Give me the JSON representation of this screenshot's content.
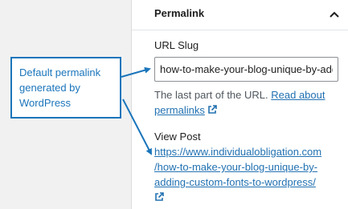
{
  "panel": {
    "title": "Permalink",
    "slug_label": "URL Slug",
    "slug_value": "how-to-make-your-blog-unique-by-adding-custom-fonts-to-wordpress",
    "help_text": "The last part of the URL.",
    "help_link": "Read about permalinks",
    "view_label": "View Post",
    "view_url_lines": [
      "https://www.individualobligation.com",
      "/how-to-make-your-blog-unique-by-",
      "adding-custom-fonts-to-wordpress/"
    ]
  },
  "callout": {
    "lines": [
      "Default permalink",
      "generated by",
      "WordPress"
    ]
  },
  "colors": {
    "accent": "#1a75bb",
    "link": "#2271b1"
  },
  "icons": [
    "chevron-up-icon",
    "external-link-icon"
  ]
}
